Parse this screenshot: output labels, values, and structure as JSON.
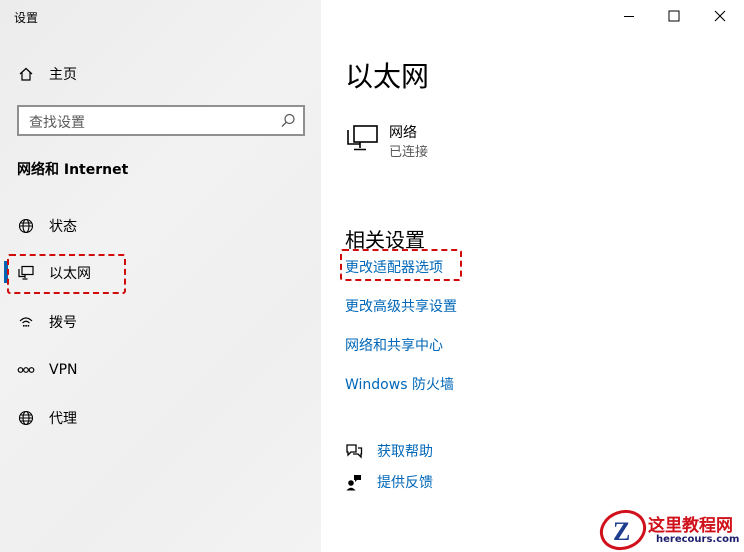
{
  "window": {
    "title": "设置",
    "controls": {
      "minimize": "—",
      "maximize": "☐",
      "close": "✕"
    }
  },
  "sidebar": {
    "home_label": "主页",
    "search_placeholder": "查找设置",
    "section_title": "网络和 Internet",
    "items": [
      {
        "label": "状态",
        "icon": "globe-icon"
      },
      {
        "label": "以太网",
        "icon": "ethernet-icon",
        "active": true
      },
      {
        "label": "拨号",
        "icon": "dialup-icon"
      },
      {
        "label": "VPN",
        "icon": "vpn-icon"
      },
      {
        "label": "代理",
        "icon": "globe-icon"
      }
    ]
  },
  "main": {
    "title": "以太网",
    "network": {
      "name": "网络",
      "status": "已连接"
    },
    "related_title": "相关设置",
    "related_links": [
      "更改适配器选项",
      "更改高级共享设置",
      "网络和共享中心",
      "Windows 防火墙"
    ],
    "help": [
      {
        "label": "获取帮助",
        "icon": "help-chat-icon"
      },
      {
        "label": "提供反馈",
        "icon": "feedback-icon"
      }
    ]
  },
  "watermark": {
    "title": "这里教程网",
    "url": "herecours.com",
    "logo_letter": "Z"
  },
  "colors": {
    "accent": "#0063b1",
    "link": "#0067b8",
    "highlight": "#d10a0a",
    "sidebar_bg": "#efefef"
  }
}
